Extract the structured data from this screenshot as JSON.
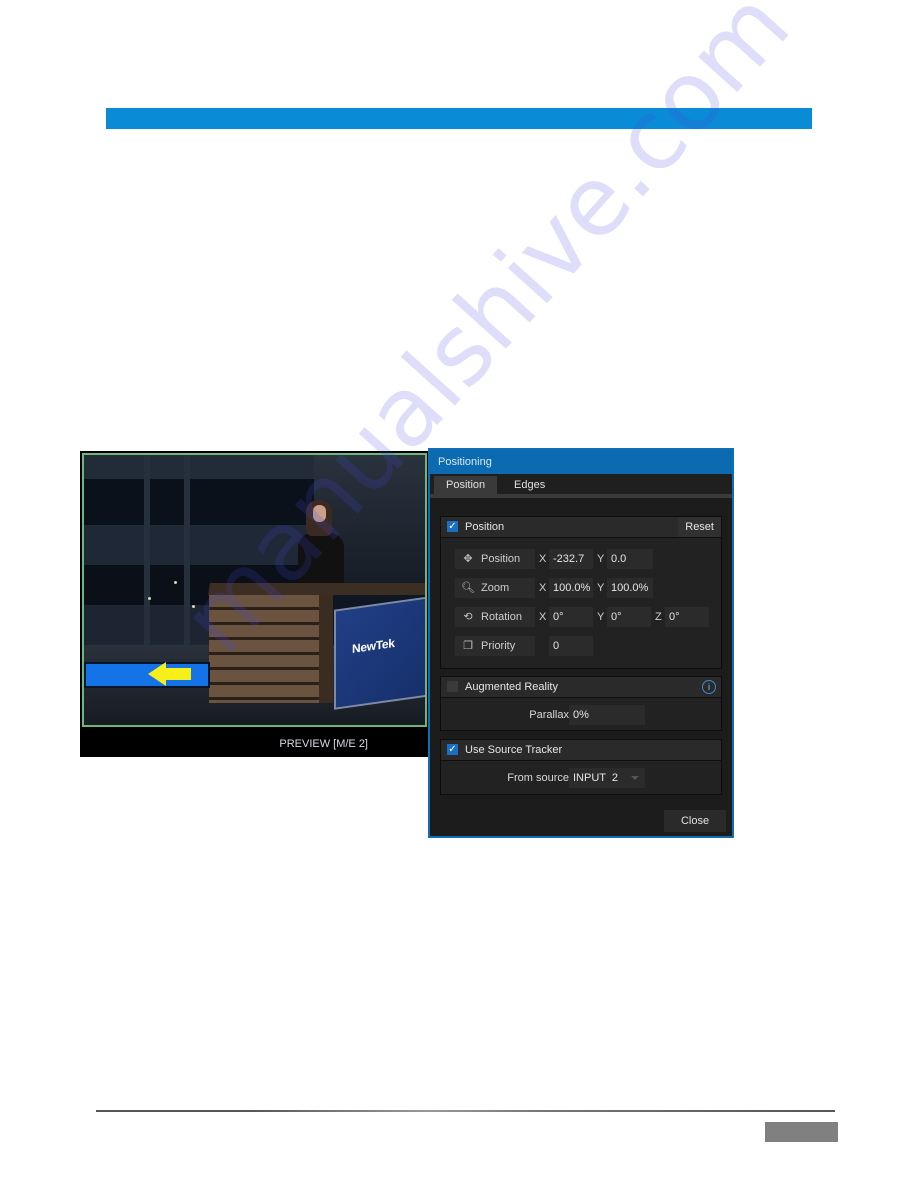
{
  "document": {
    "section_bar_color": "#0a8bd6",
    "watermark": "manualshive.com",
    "page_number": ""
  },
  "preview": {
    "label": "PREVIEW [M/E 2]",
    "desk_logo": "NewTek",
    "border_color": "#6db77a"
  },
  "dialog": {
    "title": "Positioning",
    "tabs": [
      {
        "label": "Position",
        "active": true
      },
      {
        "label": "Edges",
        "active": false
      }
    ],
    "position_group": {
      "label": "Position",
      "checked": true,
      "reset_label": "Reset",
      "rows": [
        {
          "icon": "move-arrows-icon",
          "label": "Position",
          "fields": [
            {
              "axis": "X",
              "value": "-232.7"
            },
            {
              "axis": "Y",
              "value": "0.0"
            }
          ]
        },
        {
          "icon": "magnifier-icon",
          "label": "Zoom",
          "fields": [
            {
              "axis": "X",
              "value": "100.0%"
            },
            {
              "axis": "Y",
              "value": "100.0%"
            }
          ]
        },
        {
          "icon": "rotate-icon",
          "label": "Rotation",
          "fields": [
            {
              "axis": "X",
              "value": "0°"
            },
            {
              "axis": "Y",
              "value": "0°"
            },
            {
              "axis": "Z",
              "value": "0°"
            }
          ]
        },
        {
          "icon": "layers-icon",
          "label": "Priority",
          "fields": [
            {
              "axis": "",
              "value": "0"
            }
          ]
        }
      ]
    },
    "ar_group": {
      "label": "Augmented Reality",
      "checked": false,
      "info_glyph": "i",
      "parallax_label": "Parallax",
      "parallax_value": "0%"
    },
    "tracker_group": {
      "label": "Use Source Tracker",
      "checked": true,
      "from_source_label": "From source",
      "from_source_value": "INPUT  2"
    },
    "close_label": "Close",
    "check_glyph": "✓"
  }
}
